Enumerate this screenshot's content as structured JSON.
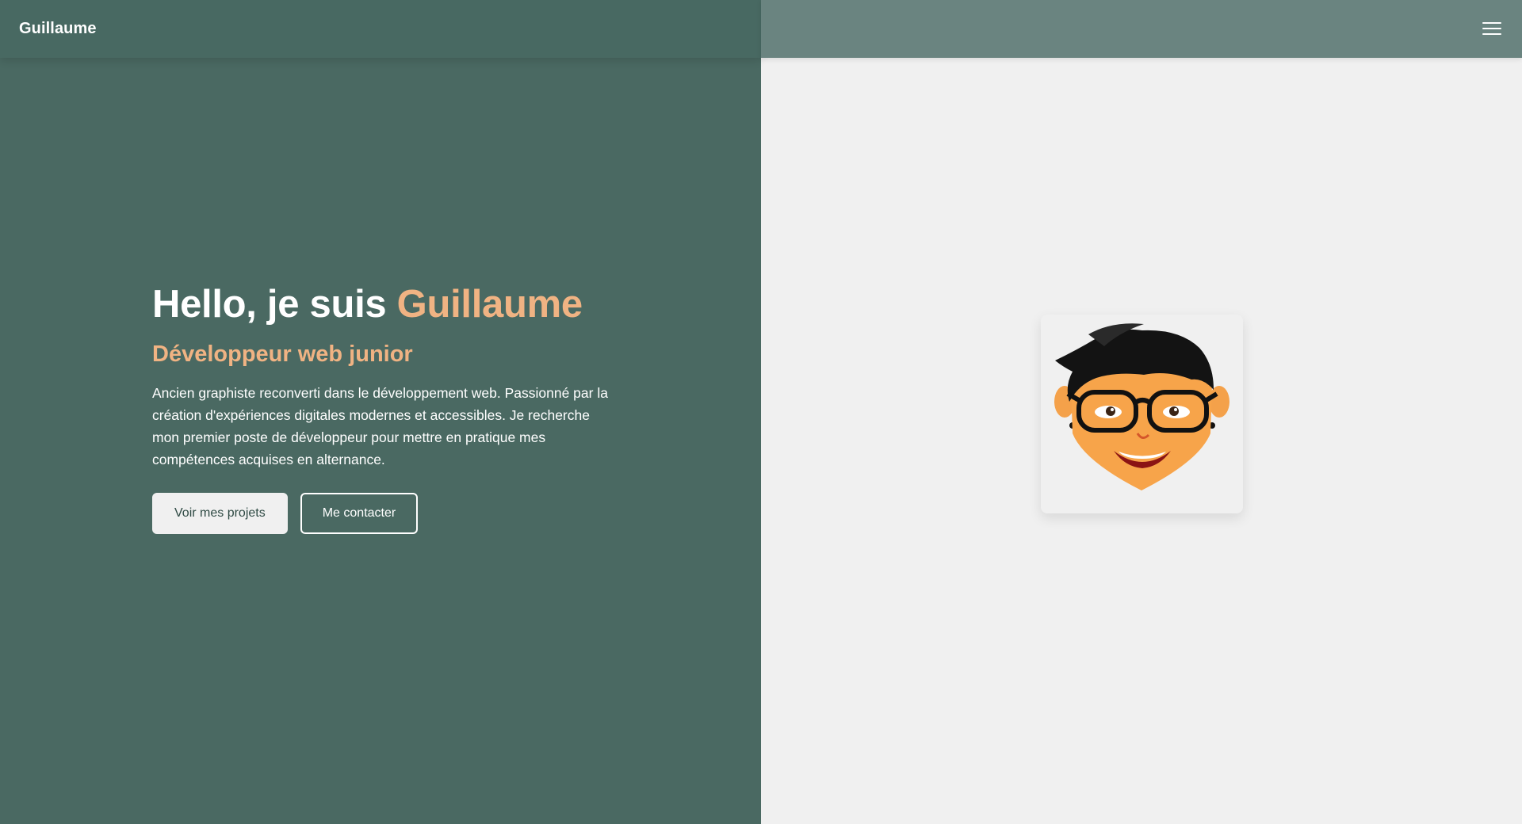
{
  "navbar": {
    "brand": "Guillaume",
    "menu_icon": "hamburger-menu-icon"
  },
  "hero": {
    "title_prefix": "Hello, je suis ",
    "title_name": "Guillaume",
    "subtitle": "Développeur web junior",
    "description": "Ancien graphiste reconverti dans le développement web. Passionné par la création d'expériences digitales modernes et accessibles. Je recherche mon premier poste de développeur pour mettre en pratique mes compétences acquises en alternance.",
    "buttons": {
      "projects": "Voir mes projets",
      "contact": "Me contacter"
    }
  },
  "avatar": {
    "icon": "cartoon-avatar-illustration"
  },
  "colors": {
    "primary": "#4a6962",
    "accent": "#f0b383",
    "background": "#f0f0f0",
    "nav_right": "#6a8480"
  }
}
